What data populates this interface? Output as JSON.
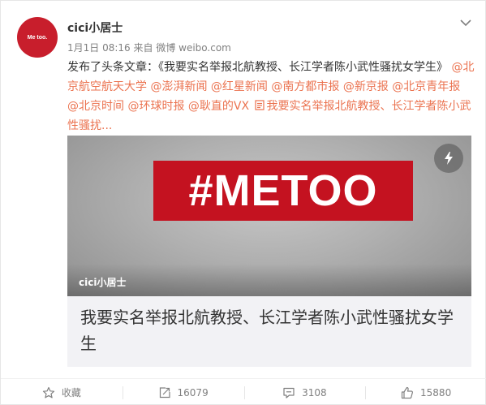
{
  "user": {
    "name": "cici小居士",
    "avatar_text": "Me too."
  },
  "meta": {
    "time": "1月1日 08:16",
    "source": "来自 微博 weibo.com"
  },
  "post": {
    "prefix": "发布了头条文章：《我要实名举报北航教授、长江学者陈小武性骚扰女学生》",
    "mentions": [
      "@北京航空航天大学",
      "@澎湃新闻",
      "@红星新闻",
      "@南方都市报",
      "@新京报",
      "@北京青年报",
      "@北京时间",
      "@环球时报",
      "@耿直的VX"
    ],
    "article_link": "我要实名举报北航教授、长江学者陈小武性骚扰..."
  },
  "article_card": {
    "banner_text": "#METOO",
    "cover_author": "cici小居士",
    "title": "我要实名举报北航教授、长江学者陈小武性骚扰女学生"
  },
  "actions": {
    "favorite": "收藏",
    "repost": "16079",
    "comment": "3108",
    "like": "15880"
  },
  "colors": {
    "link": "#eb7350",
    "avatar": "#c81e2c",
    "banner": "#c41220"
  }
}
